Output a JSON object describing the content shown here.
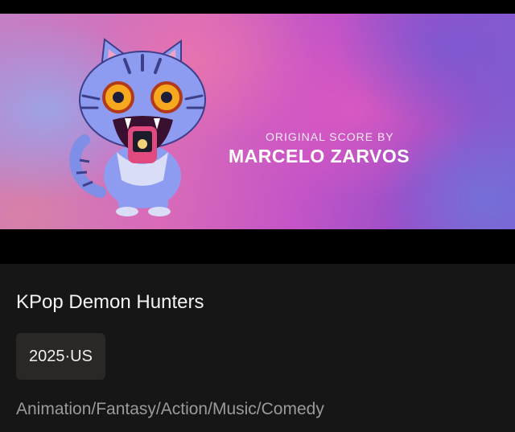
{
  "banner": {
    "score_label": "ORIGINAL SCORE BY",
    "composer": "MARCELO ZARVOS",
    "illustration": "tiger-cat-mascot-icon"
  },
  "movie": {
    "title": "KPop Demon Hunters",
    "year_country": "2025·US",
    "genres": "Animation/Fantasy/Action/Music/Comedy"
  },
  "colors": {
    "background": "#161616",
    "chip_background": "#2a2824",
    "genre_text": "#9a9a9a",
    "banner_pink": "#d96bb8",
    "banner_purple": "#7e5fd2"
  }
}
